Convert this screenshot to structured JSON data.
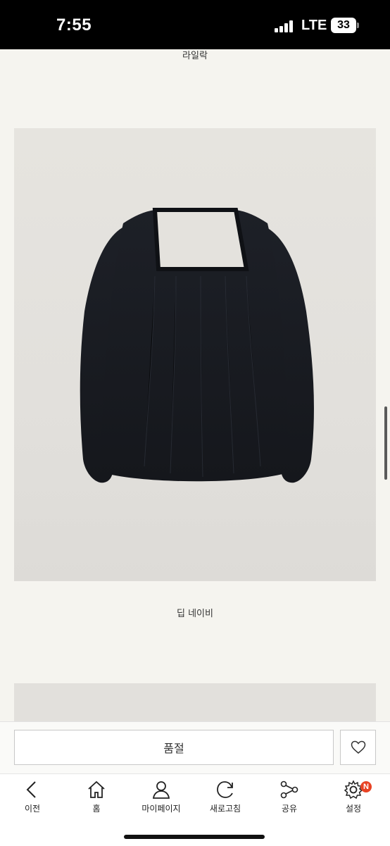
{
  "status_bar": {
    "time": "7:55",
    "network": "LTE",
    "battery": "33"
  },
  "content": {
    "color_label_top": "라일락",
    "product_image_icon": "black-blouse-photo",
    "color_label_main": "딥 네이비"
  },
  "action_bar": {
    "soldout_label": "품절",
    "wish_icon": "heart-icon"
  },
  "bottom_nav": {
    "items": [
      {
        "label": "이전",
        "icon": "back-arrow-icon"
      },
      {
        "label": "홈",
        "icon": "home-icon"
      },
      {
        "label": "마이페이지",
        "icon": "person-icon"
      },
      {
        "label": "새로고침",
        "icon": "refresh-icon"
      },
      {
        "label": "공유",
        "icon": "share-icon"
      },
      {
        "label": "설정",
        "icon": "gear-icon"
      }
    ],
    "settings_badge": "N",
    "badge_color": "#e84324"
  }
}
